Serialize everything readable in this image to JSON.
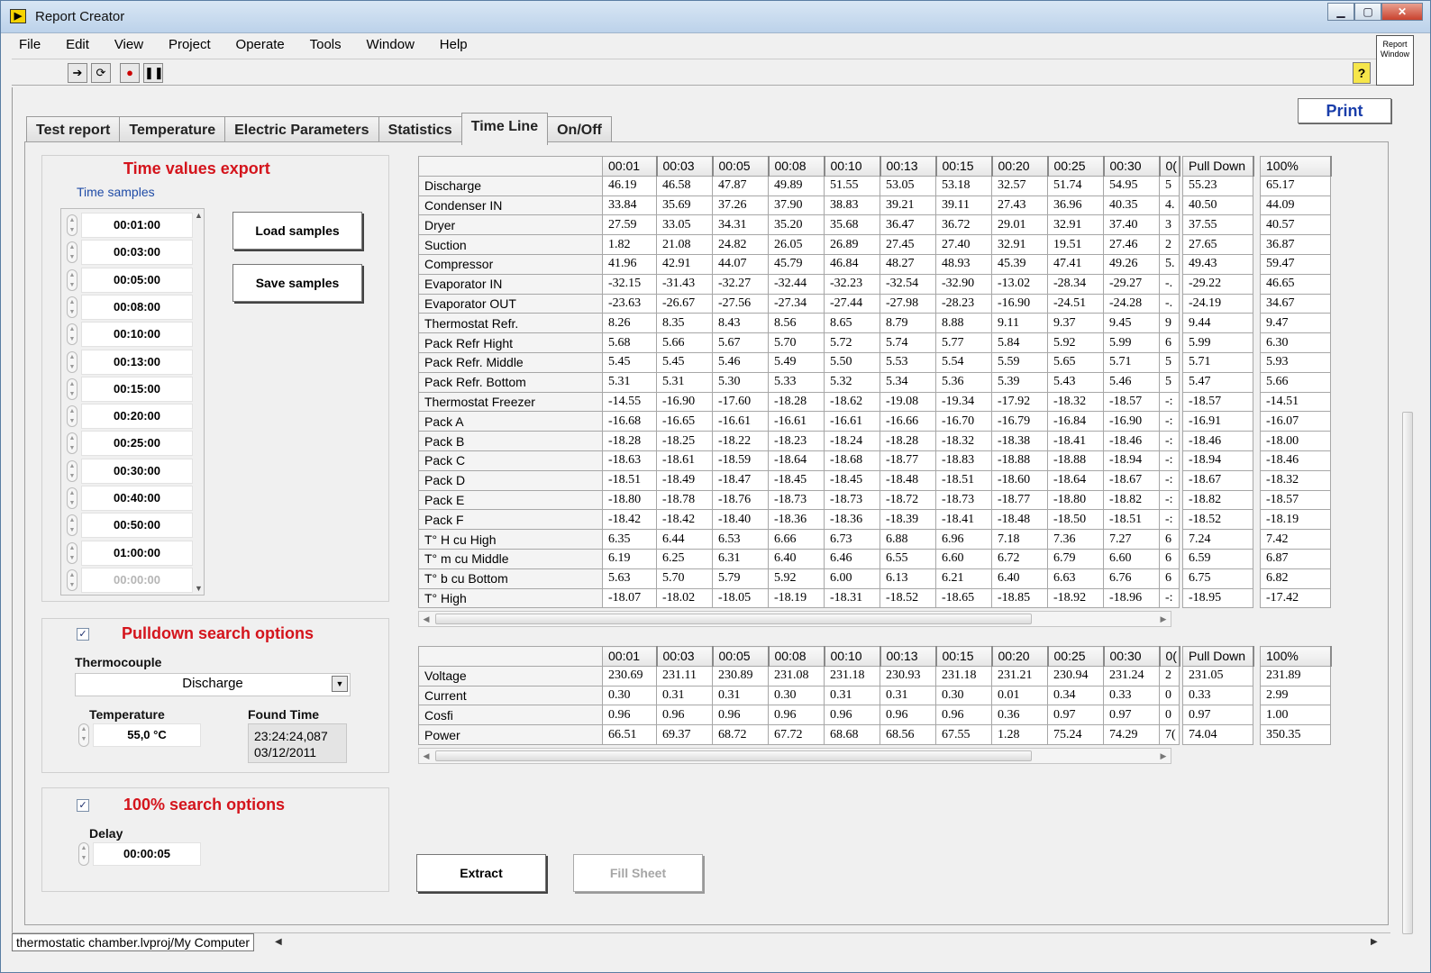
{
  "window": {
    "title": "Report Creator"
  },
  "menu": [
    "File",
    "Edit",
    "View",
    "Project",
    "Operate",
    "Tools",
    "Window",
    "Help"
  ],
  "report_thumb": "Report Window",
  "print_label": "Print",
  "tabs": [
    "Test report",
    "Temperature",
    "Electric Parameters",
    "Statistics",
    "Time Line",
    "On/Off"
  ],
  "active_tab": "Time Line",
  "time_export": {
    "title": "Time values export",
    "samples_label": "Time samples",
    "samples": [
      "00:01:00",
      "00:03:00",
      "00:05:00",
      "00:08:00",
      "00:10:00",
      "00:13:00",
      "00:15:00",
      "00:20:00",
      "00:25:00",
      "00:30:00",
      "00:40:00",
      "00:50:00",
      "01:00:00",
      "00:00:00"
    ],
    "load_label": "Load samples",
    "save_label": "Save samples"
  },
  "pulldown": {
    "title": "Pulldown search options",
    "checked": "✓",
    "thermocouple_label": "Thermocouple",
    "thermocouple_value": "Discharge",
    "temperature_label": "Temperature",
    "temperature_value": "55,0 °C",
    "found_time_label": "Found Time",
    "found_time_line1": "23:24:24,087",
    "found_time_line2": "03/12/2011"
  },
  "hundred": {
    "title": "100% search options",
    "checked": "✓",
    "delay_label": "Delay",
    "delay_value": "00:00:05"
  },
  "temp_table": {
    "columns": [
      "00:01",
      "00:03",
      "00:05",
      "00:08",
      "00:10",
      "00:13",
      "00:15",
      "00:20",
      "00:25",
      "00:30",
      "0("
    ],
    "pulldown_header": "Pull Down",
    "hundred_header": "100%",
    "rows": [
      {
        "name": "Discharge",
        "values": [
          "46.19",
          "46.58",
          "47.87",
          "49.89",
          "51.55",
          "53.05",
          "53.18",
          "32.57",
          "51.74",
          "54.95",
          "5"
        ],
        "pulldown": "55.23",
        "hundred": "65.17"
      },
      {
        "name": "Condenser IN",
        "values": [
          "33.84",
          "35.69",
          "37.26",
          "37.90",
          "38.83",
          "39.21",
          "39.11",
          "27.43",
          "36.96",
          "40.35",
          "4."
        ],
        "pulldown": "40.50",
        "hundred": "44.09"
      },
      {
        "name": "Dryer",
        "values": [
          "27.59",
          "33.05",
          "34.31",
          "35.20",
          "35.68",
          "36.47",
          "36.72",
          "29.01",
          "32.91",
          "37.40",
          "3"
        ],
        "pulldown": "37.55",
        "hundred": "40.57"
      },
      {
        "name": "Suction",
        "values": [
          "1.82",
          "21.08",
          "24.82",
          "26.05",
          "26.89",
          "27.45",
          "27.40",
          "32.91",
          "19.51",
          "27.46",
          "2"
        ],
        "pulldown": "27.65",
        "hundred": "36.87"
      },
      {
        "name": "Compressor",
        "values": [
          "41.96",
          "42.91",
          "44.07",
          "45.79",
          "46.84",
          "48.27",
          "48.93",
          "45.39",
          "47.41",
          "49.26",
          "5."
        ],
        "pulldown": "49.43",
        "hundred": "59.47"
      },
      {
        "name": "Evaporator IN",
        "values": [
          "-32.15",
          "-31.43",
          "-32.27",
          "-32.44",
          "-32.23",
          "-32.54",
          "-32.90",
          "-13.02",
          "-28.34",
          "-29.27",
          "-."
        ],
        "pulldown": "-29.22",
        "hundred": "46.65"
      },
      {
        "name": "Evaporator OUT",
        "values": [
          "-23.63",
          "-26.67",
          "-27.56",
          "-27.34",
          "-27.44",
          "-27.98",
          "-28.23",
          "-16.90",
          "-24.51",
          "-24.28",
          "-."
        ],
        "pulldown": "-24.19",
        "hundred": "34.67"
      },
      {
        "name": "Thermostat Refr.",
        "values": [
          "8.26",
          "8.35",
          "8.43",
          "8.56",
          "8.65",
          "8.79",
          "8.88",
          "9.11",
          "9.37",
          "9.45",
          "9"
        ],
        "pulldown": "9.44",
        "hundred": "9.47"
      },
      {
        "name": "Pack Refr Hight",
        "values": [
          "5.68",
          "5.66",
          "5.67",
          "5.70",
          "5.72",
          "5.74",
          "5.77",
          "5.84",
          "5.92",
          "5.99",
          "6"
        ],
        "pulldown": "5.99",
        "hundred": "6.30"
      },
      {
        "name": "Pack Refr. Middle",
        "values": [
          "5.45",
          "5.45",
          "5.46",
          "5.49",
          "5.50",
          "5.53",
          "5.54",
          "5.59",
          "5.65",
          "5.71",
          "5"
        ],
        "pulldown": "5.71",
        "hundred": "5.93"
      },
      {
        "name": "Pack Refr. Bottom",
        "values": [
          "5.31",
          "5.31",
          "5.30",
          "5.33",
          "5.32",
          "5.34",
          "5.36",
          "5.39",
          "5.43",
          "5.46",
          "5"
        ],
        "pulldown": "5.47",
        "hundred": "5.66"
      },
      {
        "name": "Thermostat Freezer",
        "values": [
          "-14.55",
          "-16.90",
          "-17.60",
          "-18.28",
          "-18.62",
          "-19.08",
          "-19.34",
          "-17.92",
          "-18.32",
          "-18.57",
          "-:"
        ],
        "pulldown": "-18.57",
        "hundred": "-14.51"
      },
      {
        "name": "Pack A",
        "values": [
          "-16.68",
          "-16.65",
          "-16.61",
          "-16.61",
          "-16.61",
          "-16.66",
          "-16.70",
          "-16.79",
          "-16.84",
          "-16.90",
          "-:"
        ],
        "pulldown": "-16.91",
        "hundred": "-16.07"
      },
      {
        "name": "Pack B",
        "values": [
          "-18.28",
          "-18.25",
          "-18.22",
          "-18.23",
          "-18.24",
          "-18.28",
          "-18.32",
          "-18.38",
          "-18.41",
          "-18.46",
          "-:"
        ],
        "pulldown": "-18.46",
        "hundred": "-18.00"
      },
      {
        "name": "Pack C",
        "values": [
          "-18.63",
          "-18.61",
          "-18.59",
          "-18.64",
          "-18.68",
          "-18.77",
          "-18.83",
          "-18.88",
          "-18.88",
          "-18.94",
          "-:"
        ],
        "pulldown": "-18.94",
        "hundred": "-18.46"
      },
      {
        "name": "Pack D",
        "values": [
          "-18.51",
          "-18.49",
          "-18.47",
          "-18.45",
          "-18.45",
          "-18.48",
          "-18.51",
          "-18.60",
          "-18.64",
          "-18.67",
          "-:"
        ],
        "pulldown": "-18.67",
        "hundred": "-18.32"
      },
      {
        "name": "Pack E",
        "values": [
          "-18.80",
          "-18.78",
          "-18.76",
          "-18.73",
          "-18.73",
          "-18.72",
          "-18.73",
          "-18.77",
          "-18.80",
          "-18.82",
          "-:"
        ],
        "pulldown": "-18.82",
        "hundred": "-18.57"
      },
      {
        "name": "Pack F",
        "values": [
          "-18.42",
          "-18.42",
          "-18.40",
          "-18.36",
          "-18.36",
          "-18.39",
          "-18.41",
          "-18.48",
          "-18.50",
          "-18.51",
          "-:"
        ],
        "pulldown": "-18.52",
        "hundred": "-18.19"
      },
      {
        "name": "T° H cu High",
        "values": [
          "6.35",
          "6.44",
          "6.53",
          "6.66",
          "6.73",
          "6.88",
          "6.96",
          "7.18",
          "7.36",
          "7.27",
          "6"
        ],
        "pulldown": "7.24",
        "hundred": "7.42"
      },
      {
        "name": "T° m cu Middle",
        "values": [
          "6.19",
          "6.25",
          "6.31",
          "6.40",
          "6.46",
          "6.55",
          "6.60",
          "6.72",
          "6.79",
          "6.60",
          "6"
        ],
        "pulldown": "6.59",
        "hundred": "6.87"
      },
      {
        "name": "T° b cu Bottom",
        "values": [
          "5.63",
          "5.70",
          "5.79",
          "5.92",
          "6.00",
          "6.13",
          "6.21",
          "6.40",
          "6.63",
          "6.76",
          "6"
        ],
        "pulldown": "6.75",
        "hundred": "6.82"
      },
      {
        "name": "T° High",
        "values": [
          "-18.07",
          "-18.02",
          "-18.05",
          "-18.19",
          "-18.31",
          "-18.52",
          "-18.65",
          "-18.85",
          "-18.92",
          "-18.96",
          "-:"
        ],
        "pulldown": "-18.95",
        "hundred": "-17.42"
      }
    ]
  },
  "elec_table": {
    "columns": [
      "00:01",
      "00:03",
      "00:05",
      "00:08",
      "00:10",
      "00:13",
      "00:15",
      "00:20",
      "00:25",
      "00:30",
      "0("
    ],
    "pulldown_header": "Pull Down",
    "hundred_header": "100%",
    "rows": [
      {
        "name": "Voltage",
        "values": [
          "230.69",
          "231.11",
          "230.89",
          "231.08",
          "231.18",
          "230.93",
          "231.18",
          "231.21",
          "230.94",
          "231.24",
          "2"
        ],
        "pulldown": "231.05",
        "hundred": "231.89"
      },
      {
        "name": "Current",
        "values": [
          "0.30",
          "0.31",
          "0.31",
          "0.30",
          "0.31",
          "0.31",
          "0.30",
          "0.01",
          "0.34",
          "0.33",
          "0"
        ],
        "pulldown": "0.33",
        "hundred": "2.99"
      },
      {
        "name": "Cosfi",
        "values": [
          "0.96",
          "0.96",
          "0.96",
          "0.96",
          "0.96",
          "0.96",
          "0.96",
          "0.36",
          "0.97",
          "0.97",
          "0"
        ],
        "pulldown": "0.97",
        "hundred": "1.00"
      },
      {
        "name": "Power",
        "values": [
          "66.51",
          "69.37",
          "68.72",
          "67.72",
          "68.68",
          "68.56",
          "67.55",
          "1.28",
          "75.24",
          "74.29",
          "7("
        ],
        "pulldown": "74.04",
        "hundred": "350.35"
      }
    ]
  },
  "extract_label": "Extract",
  "fill_sheet_label": "Fill Sheet",
  "status": {
    "path": "thermostatic chamber.lvproj/My Computer"
  }
}
